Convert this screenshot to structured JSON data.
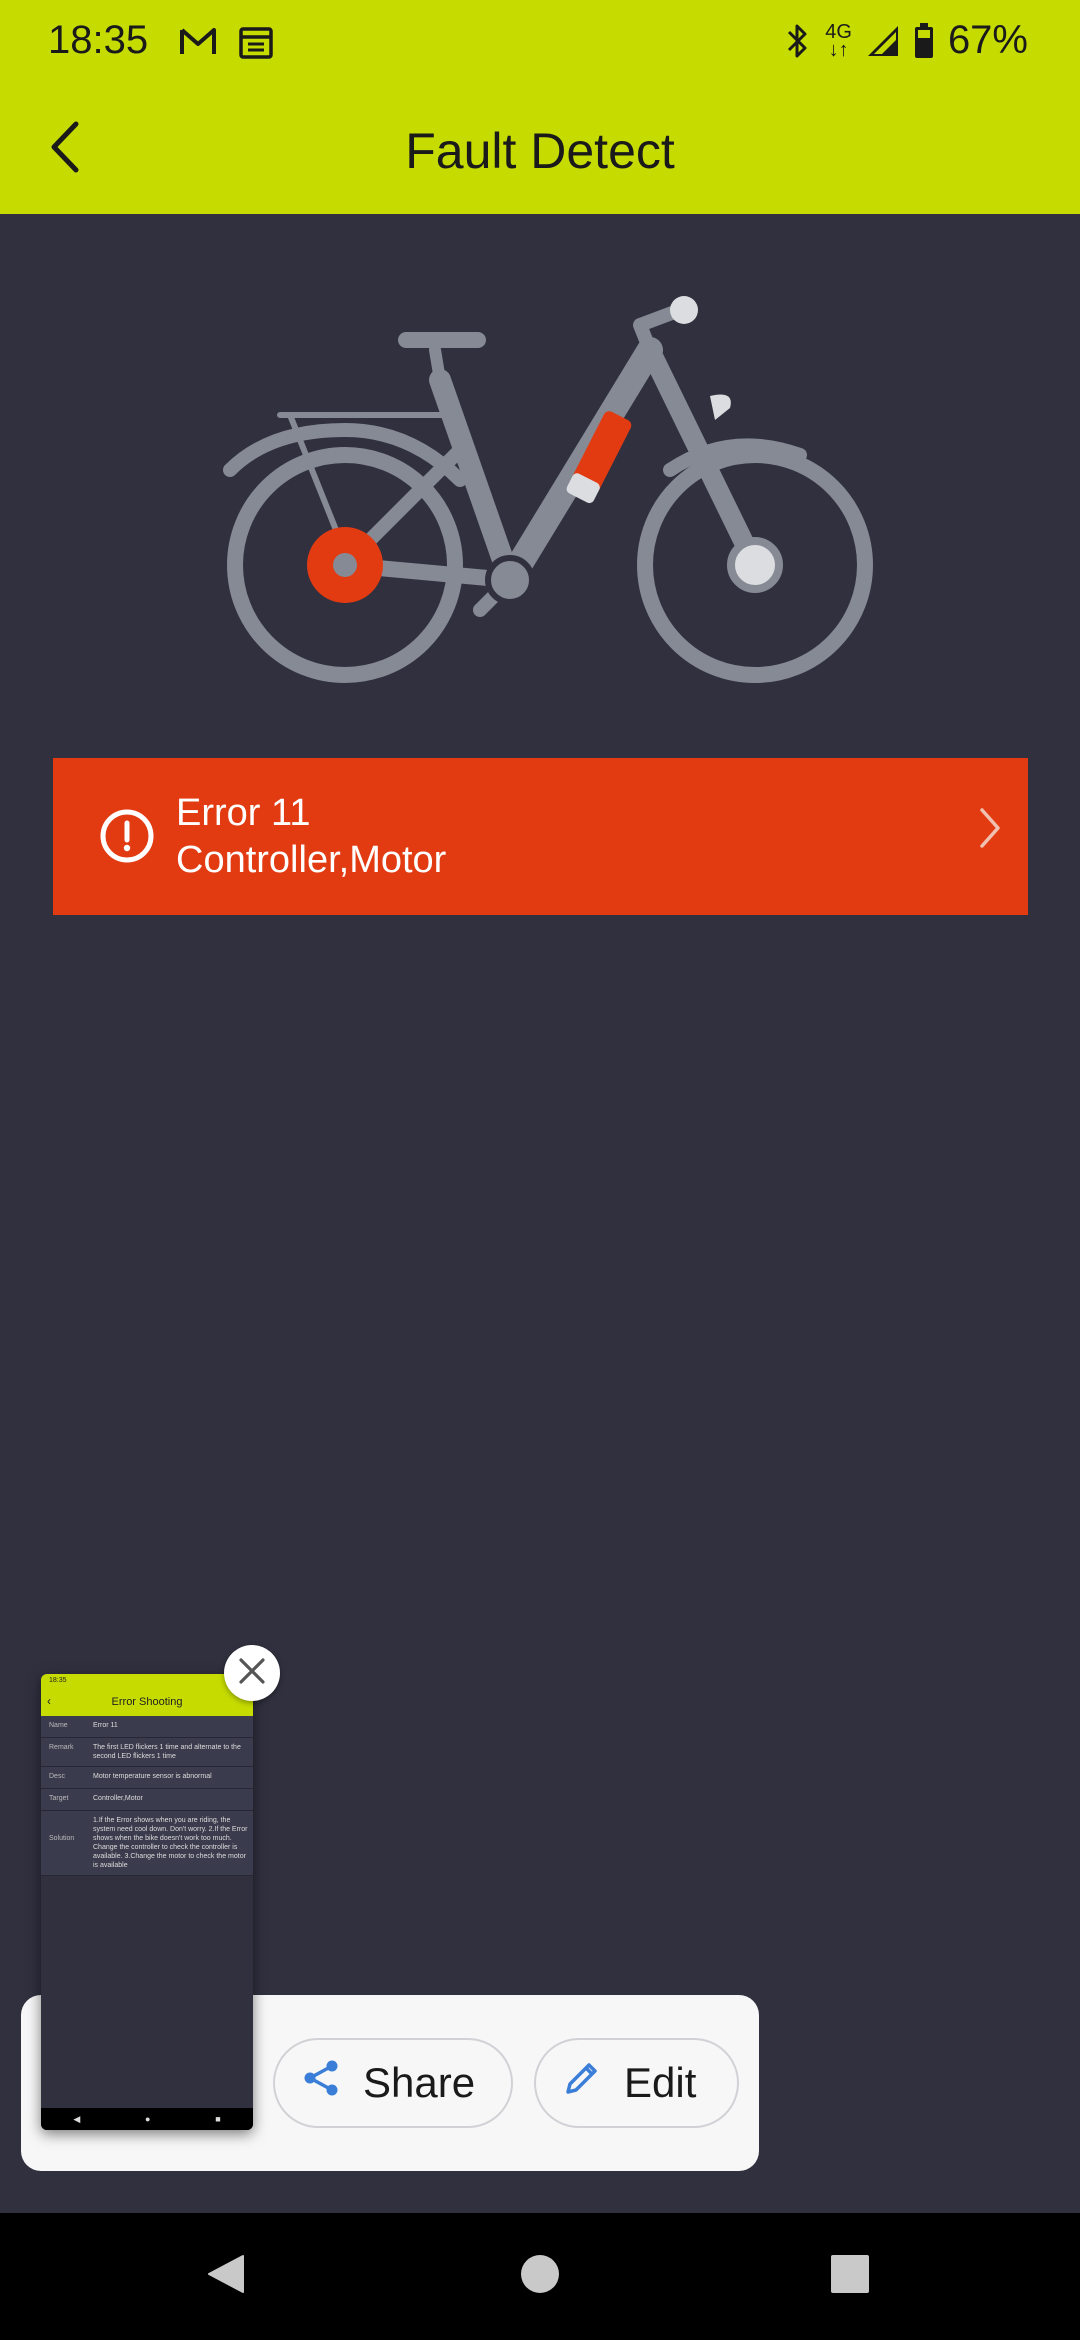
{
  "status_bar": {
    "time": "18:35",
    "battery": "67%",
    "network": "4G",
    "icons": [
      "gmail-icon",
      "calendar-icon",
      "bluetooth-icon",
      "network-4g-icon",
      "signal-icon",
      "battery-icon"
    ]
  },
  "app_bar": {
    "title": "Fault Detect",
    "back_icon": "chevron-left-icon",
    "color": "#c6dc00"
  },
  "hero": {
    "illustration": "electric-bike-illustration",
    "highlight_color": "#e23b12"
  },
  "fault": {
    "code": "Error 11",
    "target": "Controller,Motor",
    "icon": "alert-circle-icon",
    "color": "#e23b12"
  },
  "screenshot_preview": {
    "status_time": "18:35",
    "title": "Error Shooting",
    "rows": [
      {
        "key": "Name",
        "value": "Error 11"
      },
      {
        "key": "Remark",
        "value": "The first LED flickers 1 time and alternate to the second LED flickers 1 time"
      },
      {
        "key": "Desc",
        "value": "Motor temperature sensor is abnormal"
      },
      {
        "key": "Target",
        "value": "Controller,Motor"
      },
      {
        "key": "Solution",
        "value": "1.If the Error shows when you are riding, the system need cool down. Don't worry. 2.If the Error shows when the bike doesn't work too much. Change the controller to check the controller is available. 3.Change the motor to check the motor is available"
      }
    ]
  },
  "share_actions": {
    "share_label": "Share",
    "edit_label": "Edit",
    "accent": "#3b7ed8"
  },
  "nav_bar": {
    "back": "nav-back-icon",
    "home": "nav-home-icon",
    "recents": "nav-recents-icon"
  }
}
